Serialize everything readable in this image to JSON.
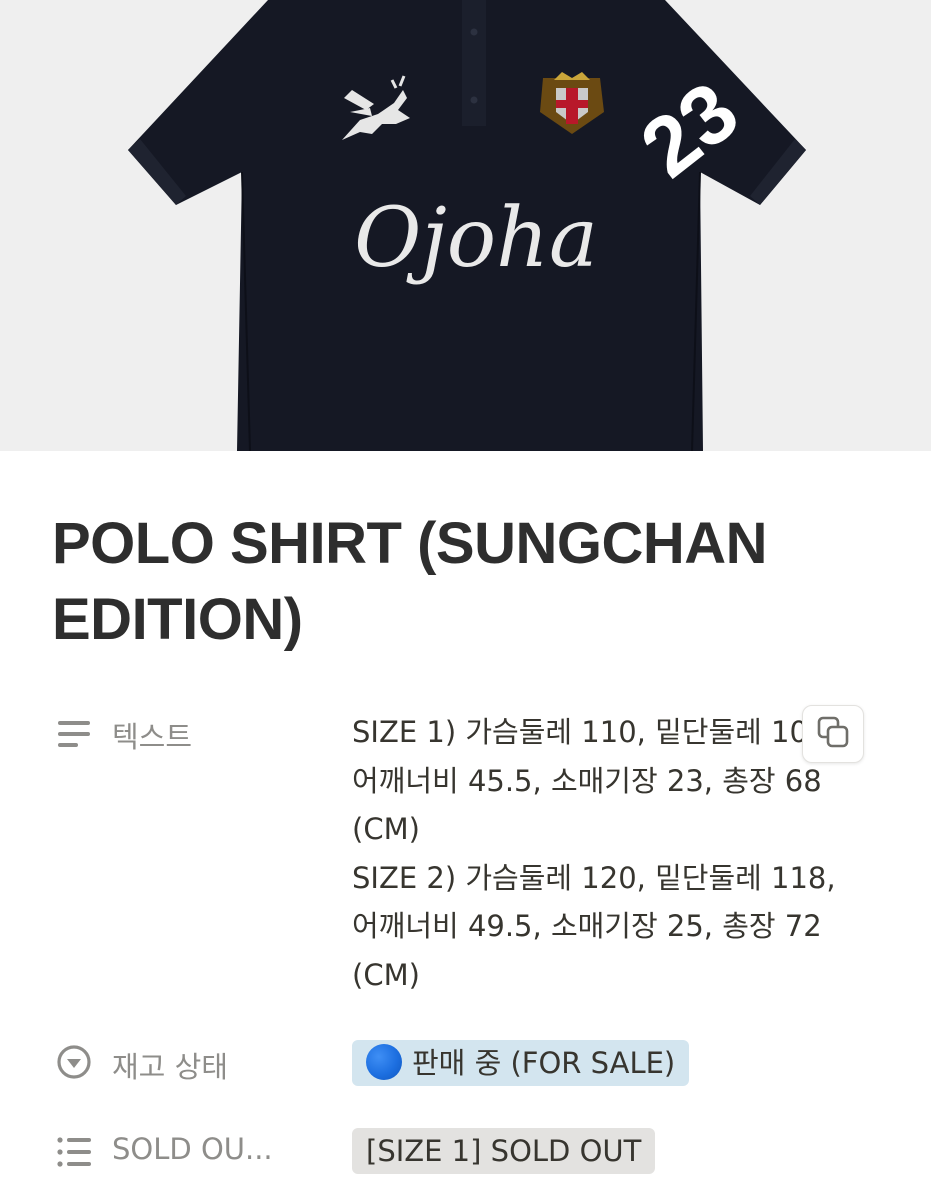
{
  "product": {
    "image_logo_text": "Ojoha",
    "image_number": "23",
    "title": "POLO SHIRT (SUNGCHAN EDITION)"
  },
  "properties": [
    {
      "icon": "text-lines-icon",
      "label": "텍스트",
      "value": "SIZE 1) 가슴둘레 110, 밑단둘레 10\n어깨너비 45.5, 소매기장 23, 총장 68\n(CM)\nSIZE 2) 가슴둘레 120, 밑단둘레 118,\n어깨너비 49.5, 소매기장 25, 총장 72\n(CM)"
    },
    {
      "icon": "select-circle-icon",
      "label": "재고 상태",
      "value": "판매 중 (FOR SALE)",
      "color": "#d3e5ef"
    },
    {
      "icon": "list-icon",
      "label": "SOLD OU...",
      "value": "[SIZE 1] SOLD OUT",
      "color": "#e3e2e0"
    }
  ],
  "copy_button": {
    "icon": "copy-icon"
  }
}
